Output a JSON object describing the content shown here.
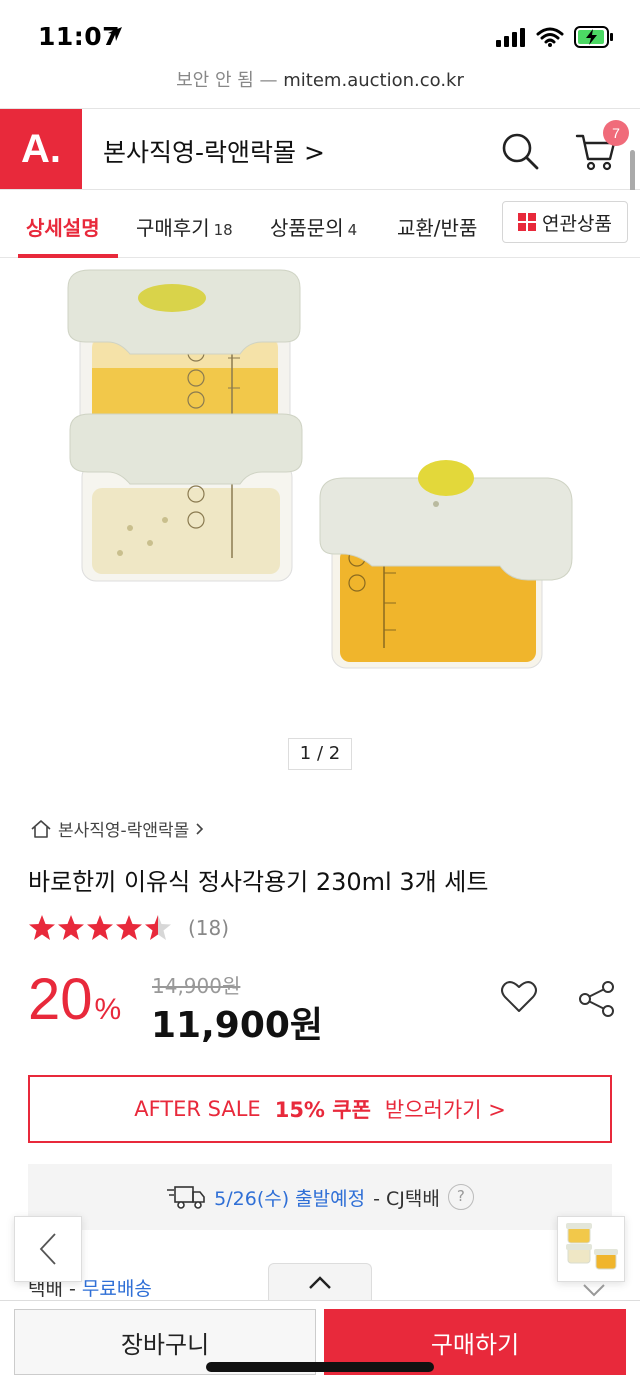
{
  "status_bar": {
    "time": "11:07"
  },
  "browser": {
    "security_label": "보안 안 됨",
    "separator": "—",
    "domain": "mitem.auction.co.kr"
  },
  "header": {
    "logo_text": "A.",
    "store_name": "본사직영-락앤락몰 >",
    "cart_count": "7"
  },
  "tabs": [
    {
      "label": "상세설명",
      "count": ""
    },
    {
      "label": "구매후기",
      "count": "18"
    },
    {
      "label": "상품문의",
      "count": "4"
    },
    {
      "label": "교환/반품",
      "count": ""
    }
  ],
  "related_button": {
    "label": "연관상품"
  },
  "gallery": {
    "page": "1 / 2"
  },
  "product": {
    "breadcrumb": "본사직영-락앤락몰",
    "title": "바로한끼 이유식 정사각용기 230ml 3개 세트",
    "rating": 4.5,
    "review_count": "(18)",
    "discount_number": "20",
    "discount_unit": "%",
    "original_price": "14,900원",
    "sale_price": "11,900원"
  },
  "coupon": {
    "prefix": "AFTER SALE",
    "highlight": "15% 쿠폰",
    "action": "받으러가기 >"
  },
  "shipping": {
    "date": "5/26(수) 출발예정",
    "carrier": "- CJ택배",
    "help": "?"
  },
  "delivery": {
    "type": "택배 - ",
    "fee": "무료배송"
  },
  "bottom_bar": {
    "cart_label": "장바구니",
    "buy_label": "구매하기"
  },
  "colors": {
    "brand": "#e8293b",
    "link": "#2f6fd6"
  }
}
